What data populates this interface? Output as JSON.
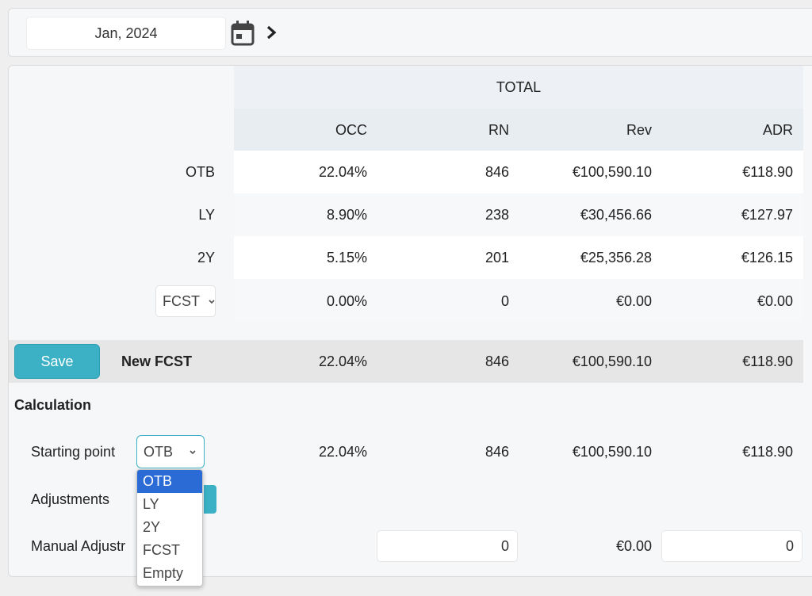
{
  "date_picker": {
    "value": "Jan, 2024",
    "icons": [
      "calendar-icon",
      "chevron-right-icon"
    ]
  },
  "table": {
    "group_header": "TOTAL",
    "columns": [
      "OCC",
      "RN",
      "Rev",
      "ADR"
    ],
    "rows": [
      {
        "label": "OTB",
        "values": [
          "22.04%",
          "846",
          "€100,590.10",
          "€118.90"
        ]
      },
      {
        "label": "LY",
        "values": [
          "8.90%",
          "238",
          "€30,456.66",
          "€127.97"
        ]
      },
      {
        "label": "2Y",
        "values": [
          "5.15%",
          "201",
          "€25,356.28",
          "€126.15"
        ]
      }
    ],
    "fcst_row": {
      "select_value": "FCST",
      "values": [
        "0.00%",
        "0",
        "€0.00",
        "€0.00"
      ]
    }
  },
  "new_fcst": {
    "save_label": "Save",
    "label": "New FCST",
    "values": [
      "22.04%",
      "846",
      "€100,590.10",
      "€118.90"
    ]
  },
  "calculation": {
    "title": "Calculation",
    "starting_point": {
      "label": "Starting point",
      "selected": "OTB",
      "values": [
        "22.04%",
        "846",
        "€100,590.10",
        "€118.90"
      ]
    },
    "adjustments": {
      "label": "Adjustments"
    },
    "manual": {
      "label": "Manual Adjustr",
      "rn_value": "0",
      "rev_value": "€0.00",
      "adr_value": "0"
    }
  },
  "dropdown": {
    "options": [
      "OTB",
      "LY",
      "2Y",
      "FCST",
      "Empty"
    ],
    "selected_index": 0
  },
  "colors": {
    "accent": "#3cb1c6",
    "selection": "#2a6bd6"
  }
}
